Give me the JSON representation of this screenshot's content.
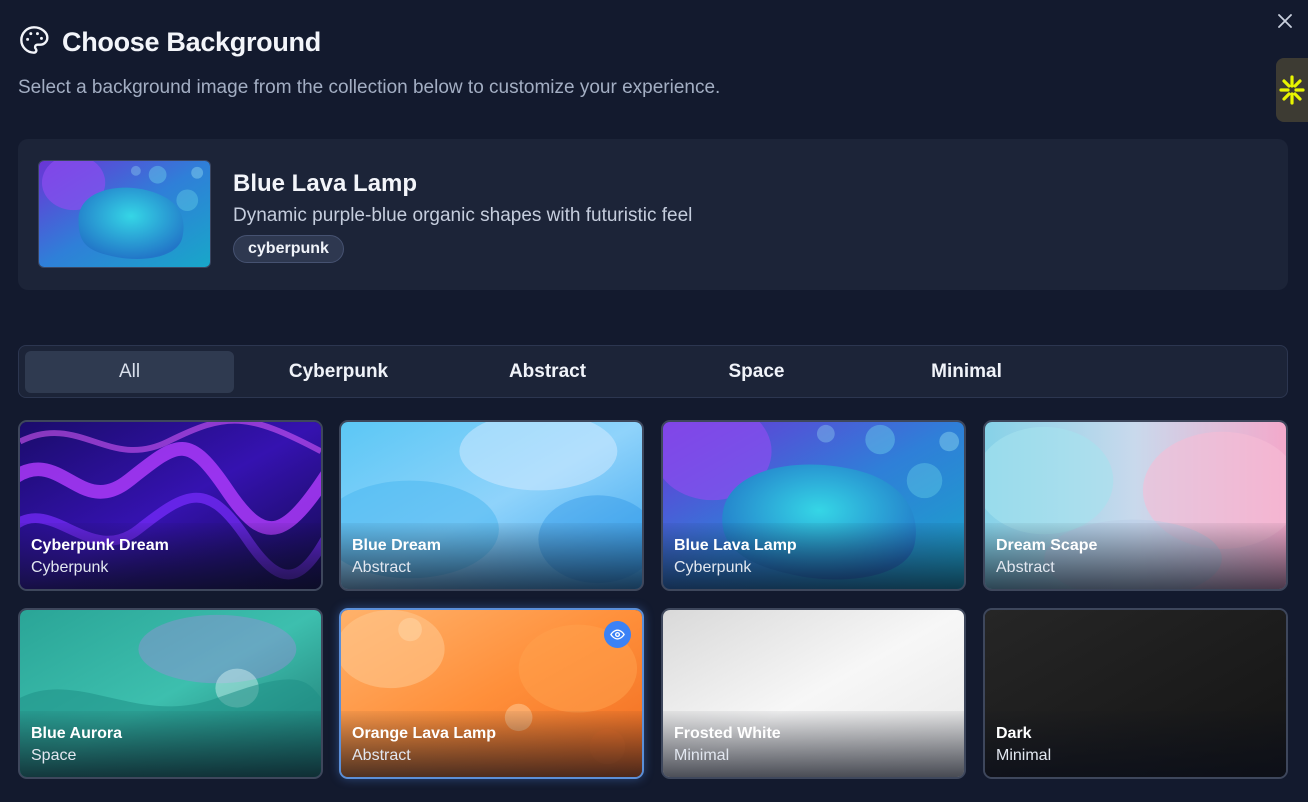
{
  "dialog": {
    "title": "Choose Background",
    "subtitle": "Select a background image from the collection below to customize your experience.",
    "icon": "palette-icon"
  },
  "preview": {
    "name": "Blue Lava Lamp",
    "description": "Dynamic purple-blue organic shapes with futuristic feel",
    "tag": "cyberpunk"
  },
  "tabs": [
    {
      "label": "All",
      "active": true
    },
    {
      "label": "Cyberpunk",
      "active": false
    },
    {
      "label": "Abstract",
      "active": false
    },
    {
      "label": "Space",
      "active": false
    },
    {
      "label": "Minimal",
      "active": false
    }
  ],
  "backgrounds": [
    {
      "name": "Cyberpunk Dream",
      "category": "Cyberpunk"
    },
    {
      "name": "Blue Dream",
      "category": "Abstract"
    },
    {
      "name": "Blue Lava Lamp",
      "category": "Cyberpunk"
    },
    {
      "name": "Dream Scape",
      "category": "Abstract"
    },
    {
      "name": "Blue Aurora",
      "category": "Space"
    },
    {
      "name": "Orange Lava Lamp",
      "category": "Abstract",
      "hovered": true
    },
    {
      "name": "Frosted White",
      "category": "Minimal"
    },
    {
      "name": "Dark",
      "category": "Minimal"
    }
  ],
  "colors": {
    "background": "#131a2e",
    "panel": "#1c2438",
    "accent": "#3b82f6",
    "widget_icon": "#e8f500"
  }
}
